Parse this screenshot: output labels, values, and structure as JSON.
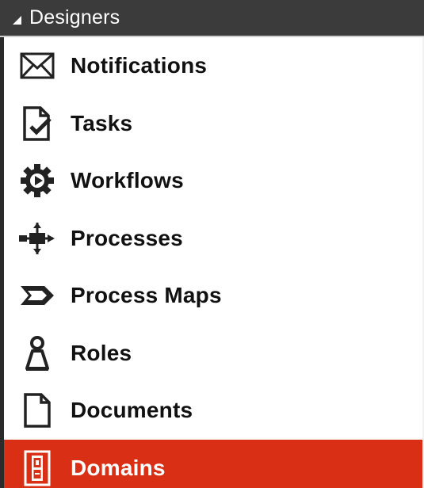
{
  "panel": {
    "header": {
      "title": "Designers",
      "expanded_icon": "triangle-expanded-icon"
    },
    "items": [
      {
        "label": "Notifications",
        "icon": "envelope-icon"
      },
      {
        "label": "Tasks",
        "icon": "task-check-icon"
      },
      {
        "label": "Workflows",
        "icon": "gear-play-icon"
      },
      {
        "label": "Processes",
        "icon": "process-flow-icon"
      },
      {
        "label": "Process Maps",
        "icon": "chevron-arrow-icon"
      },
      {
        "label": "Roles",
        "icon": "person-role-icon"
      },
      {
        "label": "Documents",
        "icon": "document-icon"
      },
      {
        "label": "Domains",
        "icon": "az-domain-icon",
        "selected": true
      }
    ]
  },
  "colors": {
    "header_bg": "#3b3b3b",
    "selected_bg": "#d93015",
    "selected_text": "#ffffff",
    "text": "#111111"
  }
}
